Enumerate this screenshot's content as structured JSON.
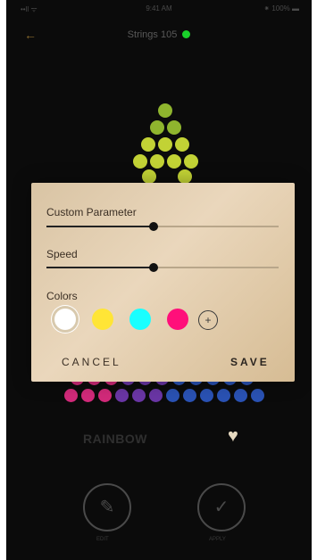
{
  "status_bar": {
    "signal": "••ll ᯤ",
    "time": "9:41 AM",
    "battery": "⁕ 100% ▬"
  },
  "header": {
    "back_icon": "←",
    "title": "Strings 105",
    "status_color": "#19d12a"
  },
  "led_colors": {
    "green": "#8fb52e",
    "yellow_green": "#c2d235",
    "pink": "#d22a7a",
    "purple": "#6a36a5",
    "blue": "#2a52b4"
  },
  "effect": {
    "name": "RAINBOW",
    "favorite_icon": "♥"
  },
  "actions": {
    "edit_label": "EDIT",
    "edit_icon": "✎",
    "apply_label": "APPLY",
    "apply_icon": "✓"
  },
  "dialog": {
    "custom_parameter": {
      "label": "Custom Parameter",
      "value_pct": 46
    },
    "speed": {
      "label": "Speed",
      "value_pct": 46
    },
    "colors_label": "Colors",
    "colors": [
      "#ffffff",
      "#ffe536",
      "#19ffff",
      "#ff0f7a"
    ],
    "selected_color_index": 0,
    "add_color_icon": "+",
    "cancel_label": "CANCEL",
    "save_label": "SAVE"
  }
}
